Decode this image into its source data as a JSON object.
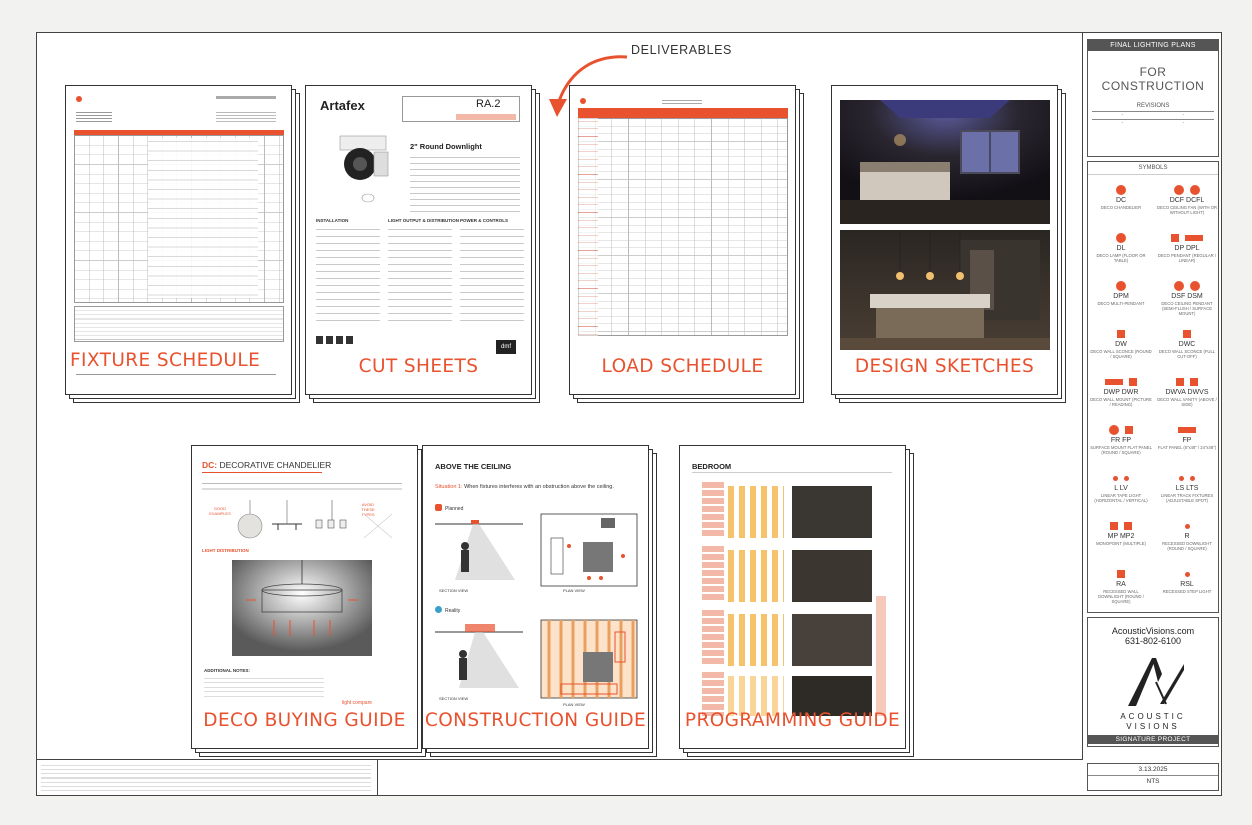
{
  "deliverables_label": "DELIVERABLES",
  "cards": {
    "fixture_schedule": "FIXTURE SCHEDULE",
    "cut_sheets": "CUT SHEETS",
    "load_schedule": "LOAD SCHEDULE",
    "design_sketches": "DESIGN SKETCHES",
    "deco_buying_guide": "DECO BUYING GUIDE",
    "construction_guide": "CONSTRUCTION GUIDE",
    "programming_guide": "PROGRAMMING GUIDE"
  },
  "cut_sheet": {
    "brand": "Artafex",
    "model": "RA.2",
    "product_title": "2\" Round Downlight",
    "sections": [
      "INSTALLATION",
      "LIGHT OUTPUT & DISTRIBUTION",
      "POWER & CONTROLS"
    ],
    "brand_footer": "dmf"
  },
  "deco_guide": {
    "title_prefix": "DC:",
    "title": "DECORATIVE CHANDELIER",
    "good_label": "GOOD EXAMPLES",
    "avoid_label": "AVOID THESE TYPES",
    "distribution_label": "LIGHT DISTRIBUTION",
    "notes_label": "ADDITIONAL NOTES:",
    "logo": "light compare"
  },
  "construction": {
    "title": "ABOVE THE CEILING",
    "situation": "Situation 1:",
    "situation_text": "When fixtures interferes with an obstruction above the ceiling.",
    "planned": "Planned",
    "reality": "Reality",
    "section_view": "SECTION VIEW",
    "plan_view": "PLAN VIEW"
  },
  "programming": {
    "title": "BEDROOM"
  },
  "titleblock": {
    "header": "FINAL LIGHTING PLANS",
    "line1": "FOR",
    "line2": "CONSTRUCTION",
    "revisions": "REVISIONS",
    "symbols": "SYMBOLS",
    "company_url": "AcousticVisions.com",
    "company_phone": "631-802-6100",
    "logo_text_1": "ACOUSTIC",
    "logo_text_2": "VISIONS",
    "project": "SIGNATURE PROJECT",
    "date": "3.13.2025",
    "scale": "NTS"
  },
  "symbols": [
    {
      "code": "DC",
      "desc": "DECO CHANDELIER"
    },
    {
      "code": "DCF   DCFL",
      "desc": "DECO CEILING FAN (WITH OR WITHOUT LIGHT)"
    },
    {
      "code": "DL",
      "desc": "DECO LAMP (FLOOR OR TABLE)"
    },
    {
      "code": "DP   DPL",
      "desc": "DECO PENDANT (REGULAR / LINEAR)"
    },
    {
      "code": "DPM",
      "desc": "DECO MULTI-PENDANT"
    },
    {
      "code": "DSF   DSM",
      "desc": "DECO CEILING PENDANT (SEMI-FLUSH / SURFACE MOUNT)"
    },
    {
      "code": "DW",
      "desc": "DECO WALL SCONCE (ROUND / SQUARE)"
    },
    {
      "code": "DWC",
      "desc": "DECO WALL SCONCE (FULL CUT-OFF)"
    },
    {
      "code": "DWP   DWR",
      "desc": "DECO WALL MOUNT (PICTURE / READING)"
    },
    {
      "code": "DWVA   DWVS",
      "desc": "DECO WALL VANITY (ABOVE / SIDE)"
    },
    {
      "code": "FR   FP",
      "desc": "SURFACE MOUNT FLAT PANEL (ROUND / SQUARE)"
    },
    {
      "code": "FP",
      "desc": "FLAT PANEL (6\"x48\" / 24\"x48\")"
    },
    {
      "code": "L   LV",
      "desc": "LINEAR TAPE LIGHT (HORIZONTAL / VERTICAL)"
    },
    {
      "code": "LS   LTS",
      "desc": "LINEAR TRACK FIXTURES (ADJUSTABLE SPOT)"
    },
    {
      "code": "MP   MP2",
      "desc": "MONOPOINT (MULTIPLE)"
    },
    {
      "code": "R",
      "desc": "RECESSED DOWNLIGHT (ROUND / SQUARE)"
    },
    {
      "code": "RA",
      "desc": "RECESSED WALL DOWNLIGHT (ROUND / SQUARE)"
    },
    {
      "code": "RSL",
      "desc": "RECESSED STEP LIGHT"
    }
  ],
  "colors": {
    "accent": "#e8522e",
    "border": "#333333",
    "titlebar": "#555555"
  }
}
